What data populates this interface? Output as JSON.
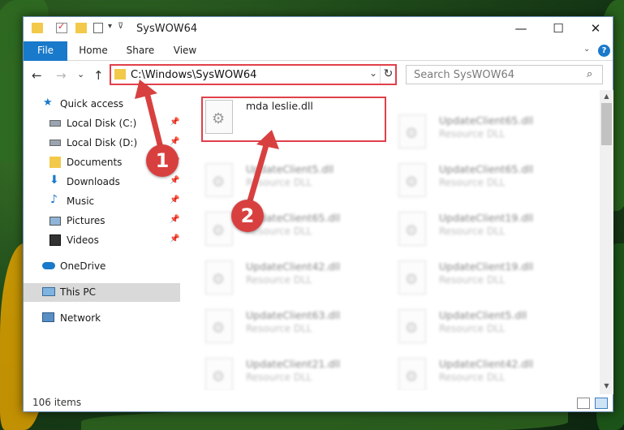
{
  "window": {
    "title": "SysWOW64"
  },
  "controls": {
    "minimize": "—",
    "maximize": "☐",
    "close": "✕"
  },
  "ribbon": {
    "tabs": [
      "File",
      "Home",
      "Share",
      "View"
    ],
    "help_icon": "?"
  },
  "address": {
    "path": "C:\\Windows\\SysWOW64",
    "dropdown": "⌄",
    "refresh": "↻"
  },
  "search": {
    "placeholder": "Search SysWOW64"
  },
  "nav_buttons": {
    "back": "←",
    "forward": "→",
    "recent": "⌄",
    "up": "↑"
  },
  "sidebar": {
    "items": [
      {
        "label": "Quick access",
        "icon": "star-icon",
        "pinned": false
      },
      {
        "label": "Local Disk (C:)",
        "icon": "drive-icon",
        "pinned": true
      },
      {
        "label": "Local Disk (D:)",
        "icon": "drive-icon",
        "pinned": true
      },
      {
        "label": "Documents",
        "icon": "document-folder-icon",
        "pinned": true
      },
      {
        "label": "Downloads",
        "icon": "download-arrow-icon",
        "pinned": true
      },
      {
        "label": "Music",
        "icon": "music-note-icon",
        "pinned": true
      },
      {
        "label": "Pictures",
        "icon": "picture-icon",
        "pinned": true
      },
      {
        "label": "Videos",
        "icon": "video-icon",
        "pinned": true
      },
      {
        "label": "OneDrive",
        "icon": "cloud-icon",
        "pinned": false
      },
      {
        "label": "This PC",
        "icon": "computer-icon",
        "pinned": false,
        "selected": true
      },
      {
        "label": "Network",
        "icon": "network-icon",
        "pinned": false
      }
    ]
  },
  "files": {
    "highlighted": {
      "name": "mda leslie.dll",
      "type": ""
    },
    "left_column": [
      {
        "name": "UpdateClient5.dll",
        "type": "Resource DLL"
      },
      {
        "name": "UpdateClient65.dll",
        "type": "Resource DLL"
      },
      {
        "name": "UpdateClient42.dll",
        "type": "Resource DLL"
      },
      {
        "name": "UpdateClient63.dll",
        "type": "Resource DLL"
      },
      {
        "name": "UpdateClient21.dll",
        "type": "Resource DLL"
      }
    ],
    "right_column": [
      {
        "name": "UpdateClient65.dll",
        "type": "Resource DLL"
      },
      {
        "name": "UpdateClient65.dll",
        "type": "Resource DLL"
      },
      {
        "name": "UpdateClient19.dll",
        "type": "Resource DLL"
      },
      {
        "name": "UpdateClient19.dll",
        "type": "Resource DLL"
      },
      {
        "name": "UpdateClient5.dll",
        "type": "Resource DLL"
      },
      {
        "name": "UpdateClient42.dll",
        "type": "Resource DLL"
      }
    ]
  },
  "status": {
    "item_count": "106 items"
  },
  "annotations": {
    "step1": "1",
    "step2": "2",
    "color": "#d84040"
  }
}
